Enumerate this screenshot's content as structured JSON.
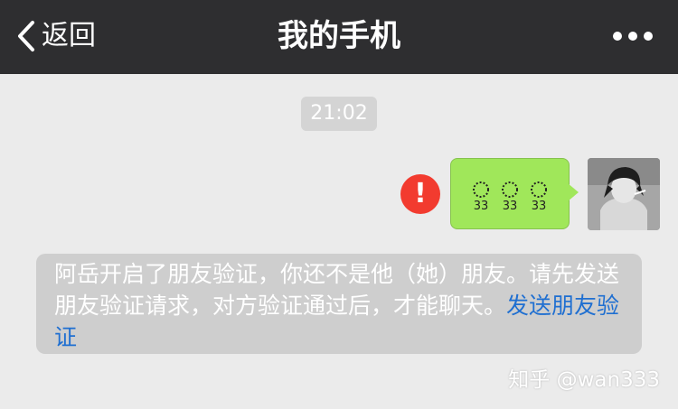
{
  "header": {
    "back_label": "返回",
    "title": "我的手机",
    "back_icon": "chevron-left-icon",
    "more_icon": "more-dots-icon"
  },
  "chat": {
    "timestamp": "21:02",
    "outgoing_message": {
      "content": "☺☺☺",
      "status_icon": "exclamation-icon",
      "status": "failed"
    }
  },
  "notice": {
    "text": "阿岳开启了朋友验证，你还不是他（她）朋友。请先发送朋友验证请求，对方验证通过后，才能聊天。",
    "link_text": "发送朋友验证"
  },
  "watermark": "知乎 @wan333",
  "colors": {
    "header_bg": "#2e2e30",
    "chat_bg": "#ebebeb",
    "bubble": "#a0e75a",
    "error": "#f23b2f",
    "link": "#1f6fd1"
  }
}
